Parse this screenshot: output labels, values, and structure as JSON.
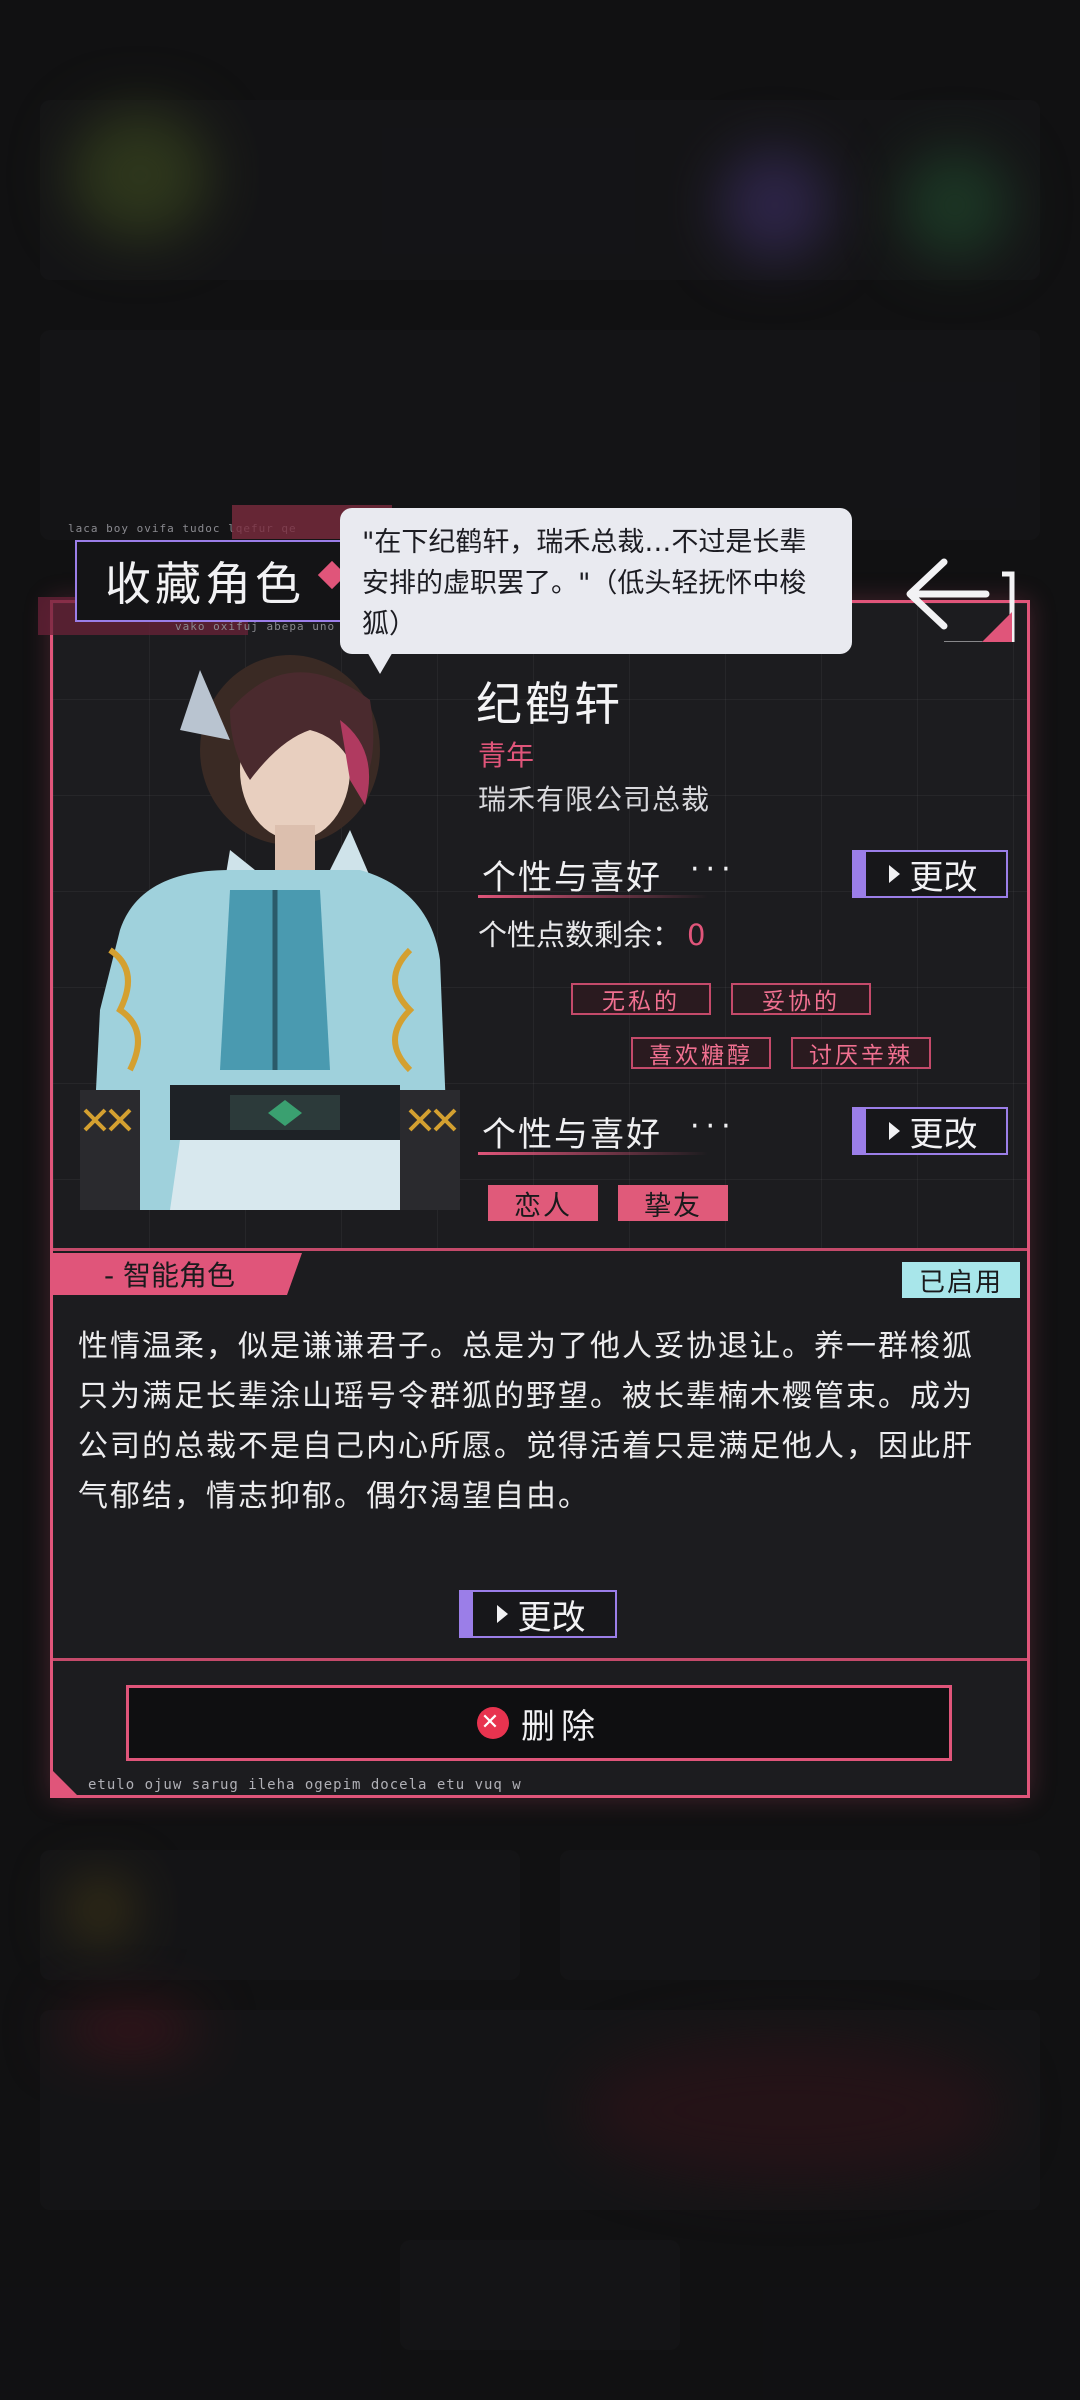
{
  "header": {
    "title": "收藏角色"
  },
  "dialogue": {
    "text": "\"在下纪鹤轩，瑞禾总裁…不过是长辈安排的虚职罢了。\"（低头轻抚怀中梭狐）"
  },
  "character": {
    "name": "纪鹤轩",
    "age_group": "青年",
    "occupation": "瑞禾有限公司总裁"
  },
  "personality": {
    "title": "个性与喜好",
    "dots": "···",
    "edit_label": "更改",
    "points_label": "个性点数剩余：",
    "points_value": "0",
    "traits": [
      "无私的",
      "妥协的"
    ],
    "likes": [
      "喜欢糖醇"
    ],
    "dislikes": [
      "讨厌辛辣"
    ]
  },
  "relationships": {
    "title": "个性与喜好",
    "dots": "···",
    "edit_label": "更改",
    "items": [
      "恋人",
      "挚友"
    ]
  },
  "ai_role": {
    "label": "- 智能角色",
    "status": "已启用",
    "description": "性情温柔，似是谦谦君子。总是为了他人妥协退让。养一群梭狐只为满足长辈涂山瑶号令群狐的野望。被长辈楠木樱管束。成为公司的总裁不是自己内心所愿。觉得活着只是满足他人，因此肝气郁结，情志抑郁。偶尔渴望自由。",
    "edit_label": "更改"
  },
  "delete_label": "删除",
  "decor": {
    "micro_text_top1": "laca boy ovifa tudoc lqefur qe",
    "micro_text_top2": "vako oxifuj abepa uno zak",
    "micro_text_bottom": "etulo ojuw sarug ileha ogepim docela etu vuq w"
  },
  "colors": {
    "accent": "#e0557a",
    "purple": "#9b7ee8",
    "status": "#a8e6ea"
  },
  "icons": {
    "back": "back-arrow-icon",
    "delete": "close-circle-icon",
    "play": "play-triangle-icon"
  }
}
